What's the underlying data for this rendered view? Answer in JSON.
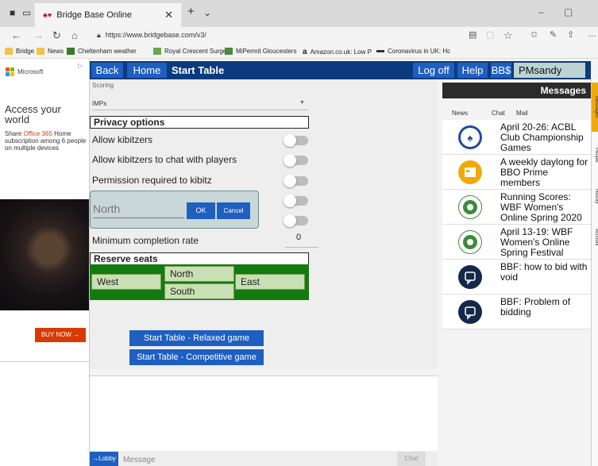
{
  "browser": {
    "tab_title": "Bridge Base Online",
    "url": "https://www.bridgebase.com/v3/",
    "bookmarks": [
      "Bridge",
      "News",
      "Cheltenham weather",
      "Royal Crescent Surge",
      "MiPermit Gloucesters",
      "Amazon.co.uk: Low P",
      "Coronavirus in UK: Hc"
    ]
  },
  "ad": {
    "brand": "Microsoft",
    "headline": "Access your world",
    "sub_prefix": "Share ",
    "sub_product": "Office 365",
    "sub_rest": " Home subscription among 6 people on multiple devices",
    "buy_label": "BUY NOW →"
  },
  "topbar": {
    "back": "Back",
    "home": "Home",
    "title": "Start Table",
    "logoff": "Log off",
    "help": "Help",
    "bbs": "BB$",
    "user": "PMsandy"
  },
  "form": {
    "scoring_label": "Scoring",
    "scoring_value": "IMPs",
    "privacy_header": "Privacy options",
    "options": [
      "Allow kibitzers",
      "Allow kibitzers to chat with players",
      "Permission required to kibitz"
    ],
    "north_placeholder": "North",
    "ok": "OK",
    "cancel": "Cancel",
    "min_rate_label": "Minimum completion rate",
    "min_rate_value": "0",
    "reserve_header": "Reserve seats",
    "seats": {
      "west": "West",
      "north": "North",
      "east": "East",
      "south": "South"
    },
    "start_relaxed": "Start Table - Relaxed game",
    "start_competitive": "Start Table - Competitive game"
  },
  "chat": {
    "lobby": "→Lobby",
    "placeholder": "Message",
    "send": "Chat"
  },
  "messages": {
    "title": "Messages",
    "tabs": [
      "News",
      "Chat",
      "Mail"
    ],
    "news": [
      "April 20-26: ACBL Club Championship Games",
      "A weekly daylong for BBO Prime members",
      "Running Scores: WBF Women's Online Spring 2020",
      "April 13-19: WBF Women's Online Spring Festival",
      "BBF: how to bid with void",
      "BBF: Problem of bidding"
    ],
    "side_tabs": [
      "Messages",
      "People",
      "History",
      "Account"
    ]
  },
  "colors": {
    "topbar": "#0b3b7e",
    "button": "#1e5fc0",
    "seat_green": "#157a0e",
    "office_red": "#d83b01"
  }
}
